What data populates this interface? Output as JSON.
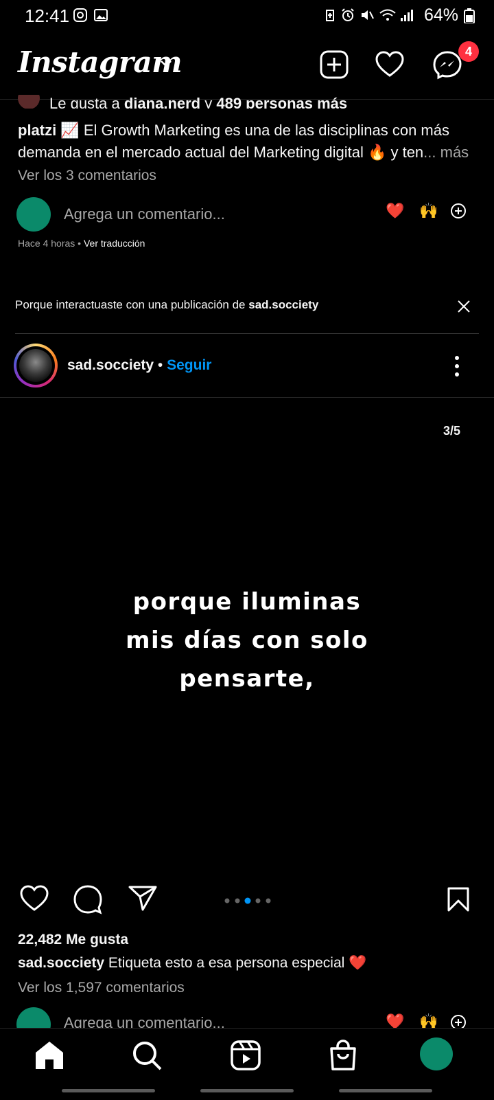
{
  "status_bar": {
    "time": "12:41",
    "battery": "64%"
  },
  "header": {
    "logo": "Instagram",
    "messages_badge": "4"
  },
  "post1": {
    "liked_by_prefix": "Le gusta a ",
    "liked_by_user": "diana.nerd",
    "liked_by_mid": " y ",
    "liked_by_count": "489 personas más",
    "caption_user": "platzi",
    "caption_text": " 📈 El Growth Marketing es una de las disciplinas con más demanda en el mercado actual del Marketing digital 🔥 y ten",
    "caption_more": "... más",
    "view_comments": "Ver los 3 comentarios",
    "add_comment": "Agrega un comentario...",
    "quick_reactions": [
      "❤️",
      "🙌"
    ],
    "time_ago": "Hace 4 horas",
    "translate": "Ver traducción"
  },
  "suggestion": {
    "reason_prefix": "Porque interactuaste con una publicación de ",
    "reason_user": "sad.socciety"
  },
  "post2": {
    "username": "sad.socciety",
    "separator": "•",
    "follow": "Seguir",
    "counter": "3/5",
    "image_text": [
      "porque iluminas",
      "mis días con solo",
      "pensarte,"
    ],
    "carousel_total": 5,
    "carousel_active": 3,
    "likes": "22,482 Me gusta",
    "caption_user": "sad.socciety",
    "caption_text": " Etiqueta esto a esa persona especial ❤️",
    "view_comments": "Ver los 1,597 comentarios",
    "add_comment": "Agrega un comentario..."
  },
  "nav": {
    "items": [
      "home-icon",
      "search-icon",
      "reels-icon",
      "shop-icon",
      "profile-avatar"
    ]
  },
  "colors": {
    "accent": "#0095f6",
    "badge": "#ff3040",
    "avatar": "#0b8a6a"
  }
}
